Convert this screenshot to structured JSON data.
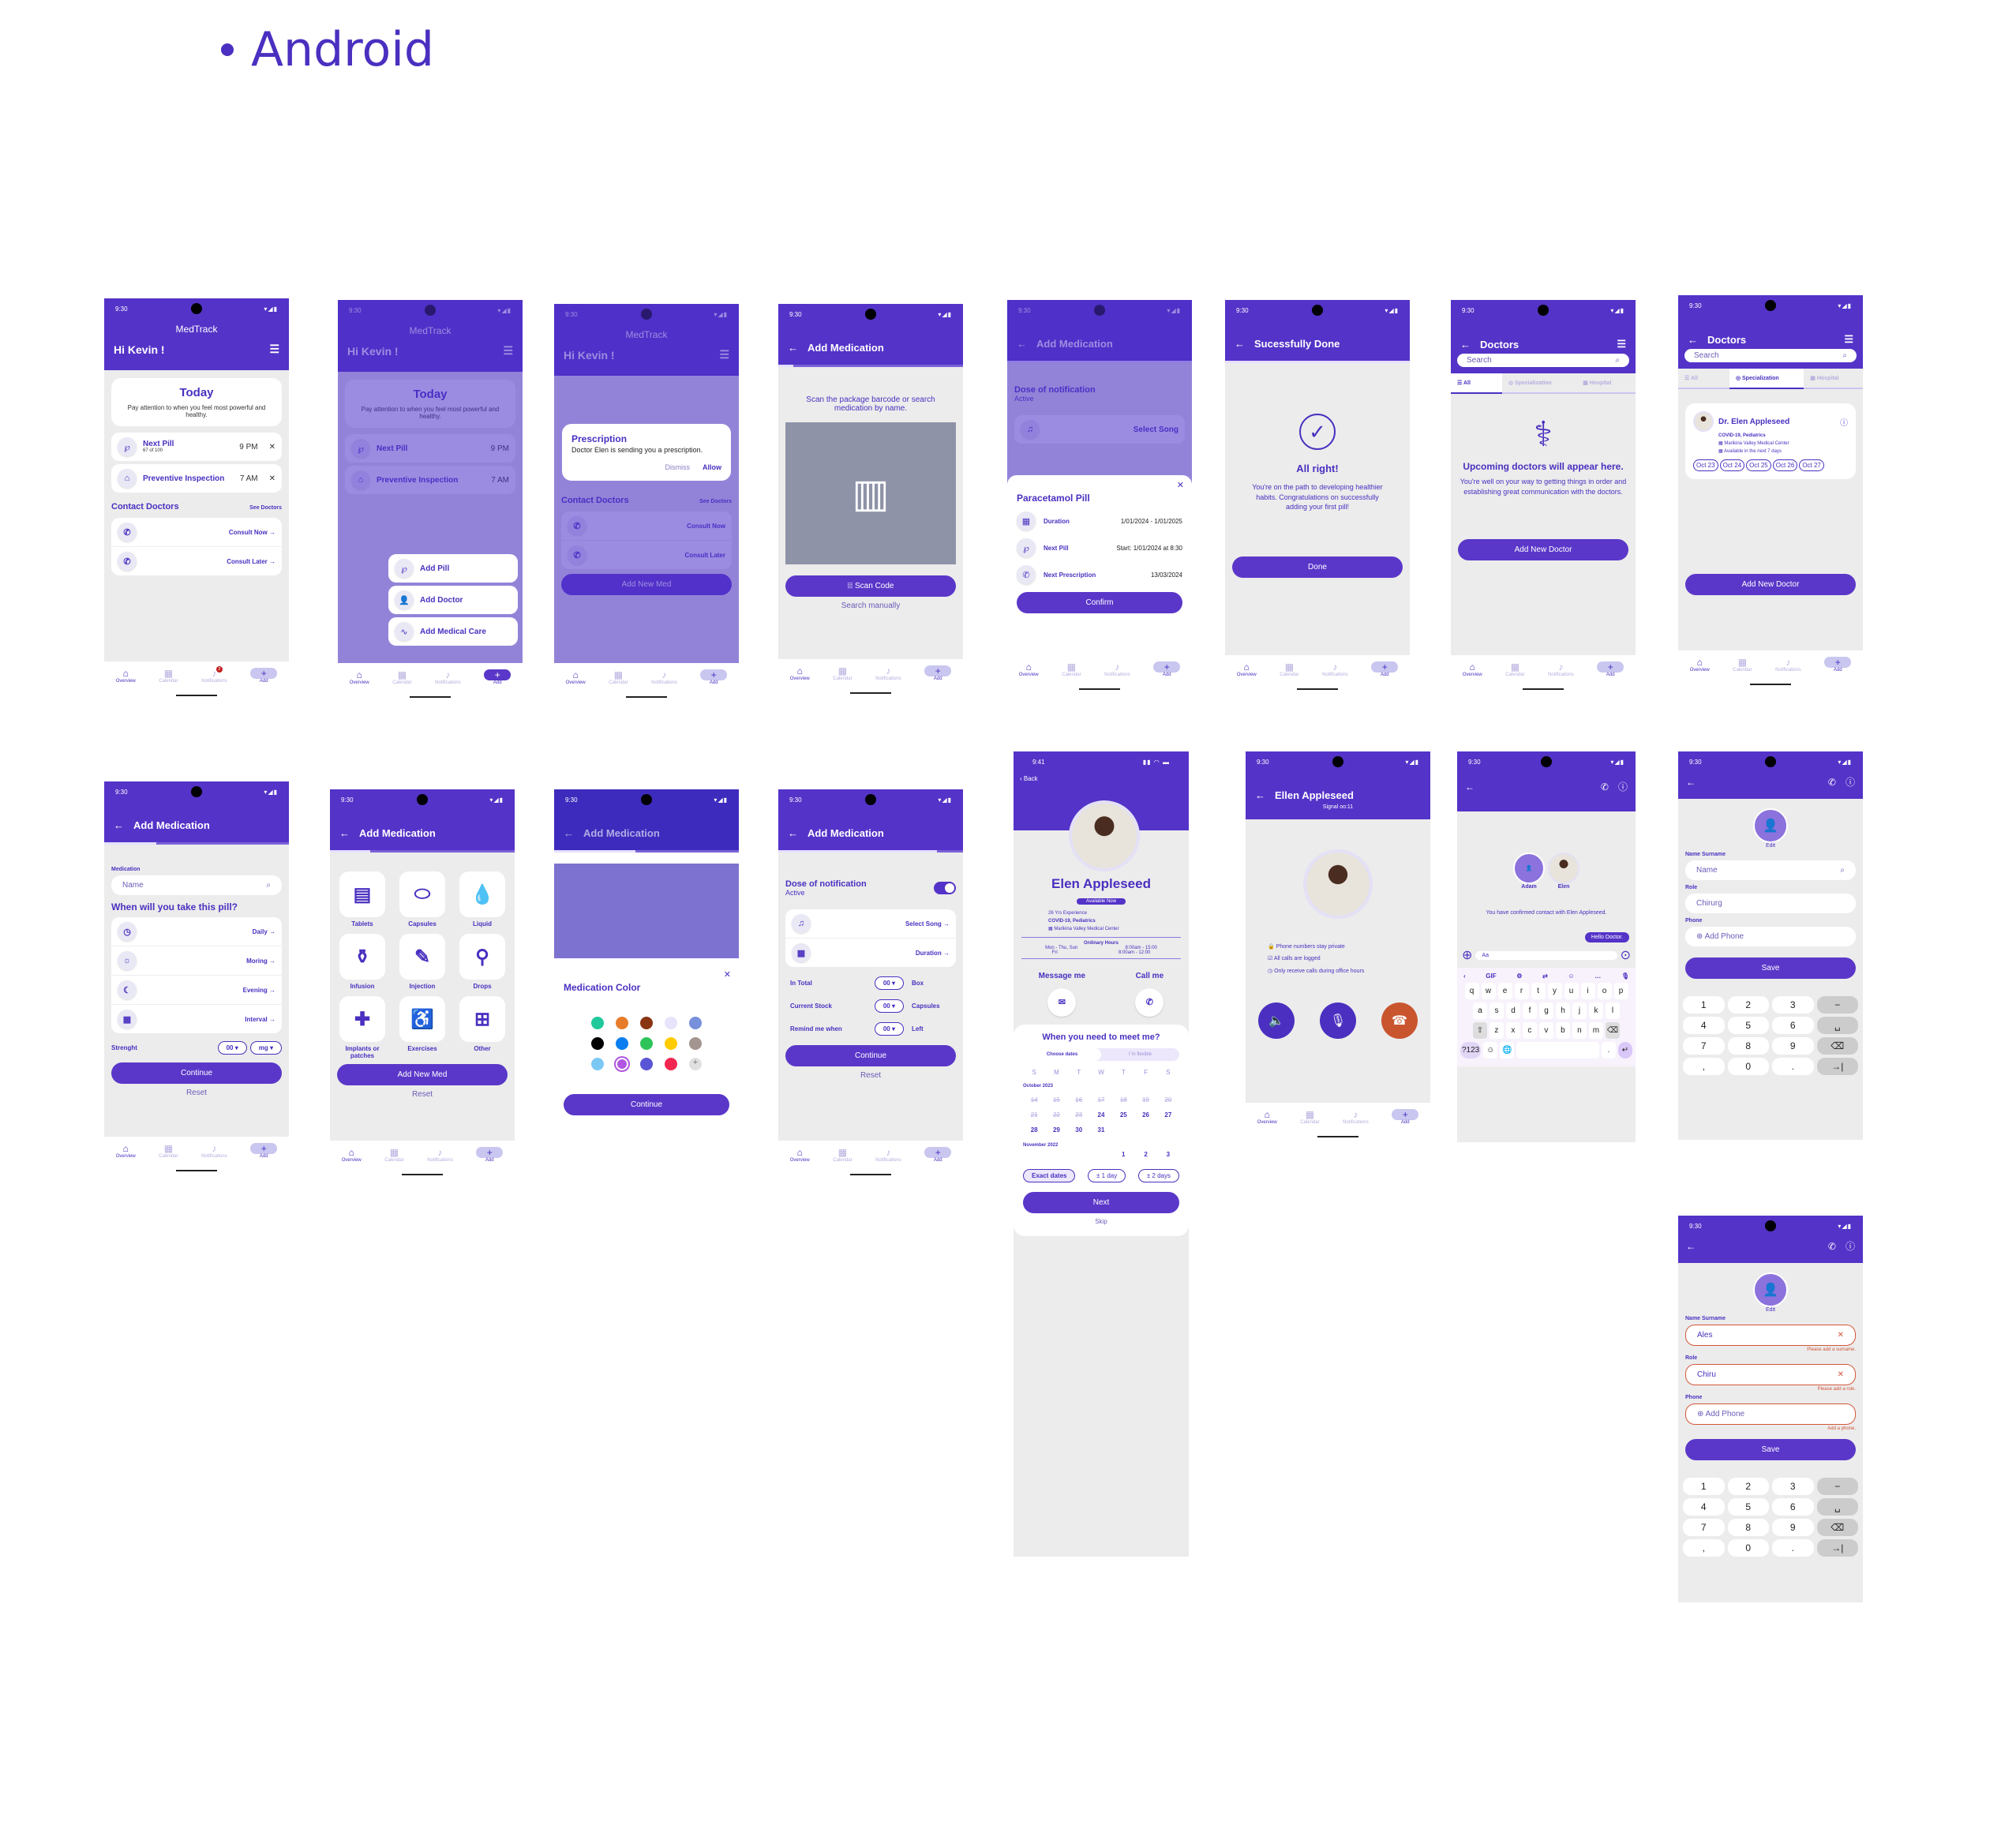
{
  "page": {
    "title": "Android"
  },
  "status": {
    "time": "9:30",
    "time_ios": "9:41"
  },
  "nav": {
    "items": [
      {
        "label": "Overview",
        "icon": "home-icon"
      },
      {
        "label": "Calendar",
        "icon": "calendar-icon"
      },
      {
        "label": "Notifications",
        "icon": "bell-icon",
        "badge": "3"
      },
      {
        "label": "Add",
        "icon": "plus-icon"
      }
    ]
  },
  "home": {
    "app_name": "MedTrack",
    "greeting": "Hi Kevin !",
    "today_title": "Today",
    "today_text": "Pay attention to when you feel most powerful and healthy.",
    "reminders": [
      {
        "title": "Next Pill",
        "sub": "67 of 100",
        "time": "9 PM"
      },
      {
        "title": "Preventive Inspection",
        "sub": "",
        "time": "7 AM"
      }
    ],
    "contact_title": "Contact Doctors",
    "see_doctors": "See Doctors",
    "consult": [
      "Consult Now",
      "Consult Later"
    ]
  },
  "add_menu": {
    "items": [
      "Add Pill",
      "Add Doctor",
      "Add Medical Care"
    ]
  },
  "prescription_dialog": {
    "title": "Prescription",
    "text": "Doctor Elen is sending you a prescription.",
    "dismiss": "Dismiss",
    "allow": "Allow",
    "add_new_med": "Add New Med"
  },
  "scan": {
    "title": "Add Medication",
    "text": "Scan the package barcode or search medication by name.",
    "scan_button": "Scan Code",
    "search_manually": "Search manually"
  },
  "summary_sheet": {
    "bg_title": "Dose of notification",
    "bg_status": "Active",
    "bg_select_song": "Select Song",
    "title": "Paracetamol Pill",
    "rows": [
      {
        "label": "Duration",
        "value": "1/01/2024 - 1/01/2025"
      },
      {
        "label": "Next Pill",
        "value": "Start: 1/01/2024 at 8:30"
      },
      {
        "label": "Next Prescription",
        "value": "13/03/2024"
      }
    ],
    "confirm": "Confirm"
  },
  "success": {
    "title": "Sucessfully Done",
    "heading": "All right!",
    "text": "You're on the path to developing healthier habits. Congratulations on successfully adding your first pill!",
    "done": "Done"
  },
  "doctors": {
    "title": "Doctors",
    "search_placeholder": "Search",
    "tabs": [
      "All",
      "Specialization",
      "Hospital"
    ],
    "empty_heading": "Upcoming doctors will appear here.",
    "empty_text": "You're well on your way to getting things in order and establishing great communication with the doctors.",
    "add_button": "Add New Doctor",
    "card": {
      "name": "Dr. Elen Appleseed",
      "spec": "COVID-19, Pediatrics",
      "hospital": "Marikina Valley Medical Center",
      "availability": "Available in the next 7 days",
      "dates": [
        "Oct 23",
        "Oct 24",
        "Oct 25",
        "Oct 26",
        "Oct 27"
      ]
    }
  },
  "add_med_form": {
    "title": "Add Medication",
    "medication_label": "Medication",
    "name_placeholder": "Name",
    "question": "When will you take this pill?",
    "options": [
      "Daily",
      "Moring",
      "Evening",
      "Interval"
    ],
    "strength_label": "Strenght",
    "strength_value": "00",
    "strength_unit": "mg",
    "continue": "Continue",
    "reset": "Reset"
  },
  "med_types": {
    "items": [
      "Tablets",
      "Capsules",
      "Liquid",
      "Infusion",
      "Injection",
      "Drops",
      "Implants or patches",
      "Exercises",
      "Other"
    ],
    "add_button": "Add New Med",
    "reset": "Reset"
  },
  "med_color": {
    "title": "Medication Color",
    "colors": [
      "#1fc99b",
      "#e77d2a",
      "#8a3512",
      "#e6e3fa",
      "#7690db",
      "#000000",
      "#0a7df0",
      "#2fc45a",
      "#ffcc00",
      "#a3958f",
      "#7cc8f5",
      "#b156e0",
      "#5a54d6",
      "#f2274f",
      "#e0e0e0"
    ],
    "selected_index": 11,
    "continue": "Continue"
  },
  "notification_setup": {
    "title": "Dose of notification",
    "status": "Active",
    "toggle_on": true,
    "rows": [
      "Select Song",
      "Duration"
    ],
    "fields": [
      {
        "label": "In Total",
        "value": "00",
        "unit": "Box"
      },
      {
        "label": "Current Stock",
        "value": "00",
        "unit": "Capsules"
      },
      {
        "label": "Remind me when",
        "value": "00",
        "unit": "Left"
      }
    ],
    "continue": "Continue",
    "reset": "Reset"
  },
  "profile": {
    "back": "Back",
    "name": "Elen Appleseed",
    "badge": "Available Now",
    "experience": "26 Yrs Experience",
    "spec": "COVID-19, Pediatrics",
    "hospital": "Marikina Valley Medical Center",
    "hours_title": "Ordinary Hours",
    "hours": [
      {
        "days": "Mon - Thu, Sun",
        "time": "8:00am - 15:00"
      },
      {
        "days": "Fri",
        "time": "8:00am - 12:00"
      }
    ],
    "message": "Message me",
    "call": "Call me",
    "meet_title": "When you need to meet me?",
    "seg": [
      "Choose dates",
      "I´m flexible"
    ],
    "weekdays": [
      "S",
      "M",
      "T",
      "W",
      "T",
      "F",
      "S"
    ],
    "month1": "October 2023",
    "days_past": [
      "14",
      "15",
      "16",
      "17",
      "18",
      "19",
      "20",
      "21",
      "22",
      "23"
    ],
    "days_active": [
      "24",
      "25",
      "26",
      "27",
      "28",
      "29",
      "30",
      "31"
    ],
    "month2": "November 2022",
    "days_m2": [
      "1",
      "2",
      "3"
    ],
    "flex": [
      "Exact dates",
      "± 1 day",
      "± 2 days"
    ],
    "next": "Next",
    "skip": "Skip"
  },
  "call": {
    "name": "Ellen Appleseed",
    "signal": "Signal oo:11",
    "notes": [
      "Phone numbers stay private",
      "All calls are logged",
      "Only receive calls during office hours"
    ]
  },
  "chat": {
    "users": [
      "Adam",
      "Elen"
    ],
    "confirm": "You have confirmed contact with Elen Appleseed.",
    "message": "Hello Doctor.",
    "input_placeholder": "Aa",
    "kb_rows": [
      [
        "q",
        "w",
        "e",
        "r",
        "t",
        "y",
        "u",
        "i",
        "o",
        "p"
      ],
      [
        "a",
        "s",
        "d",
        "f",
        "g",
        "h",
        "j",
        "k",
        "l"
      ],
      [
        "z",
        "x",
        "c",
        "v",
        "b",
        "n",
        "m"
      ]
    ],
    "kb_sym": "?123",
    "kb_gif": "GIF"
  },
  "contact_form": {
    "edit": "Edit",
    "name_label": "Name Surname",
    "name_placeholder": "Name",
    "role_label": "Role",
    "role_value": "Chirurg",
    "phone_label": "Phone",
    "add_phone": "Add Phone",
    "save": "Save",
    "keys": [
      "1",
      "2",
      "3",
      "−",
      "4",
      "5",
      "6",
      "␣",
      "7",
      "8",
      "9",
      "⌫",
      ",",
      "0",
      ".",
      "→|"
    ]
  },
  "contact_form_error": {
    "name_value": "Ales",
    "role_value": "Chiru",
    "name_error": "Please add a surname.",
    "role_error": "Please add a role.",
    "phone_error": "Add a phone."
  }
}
